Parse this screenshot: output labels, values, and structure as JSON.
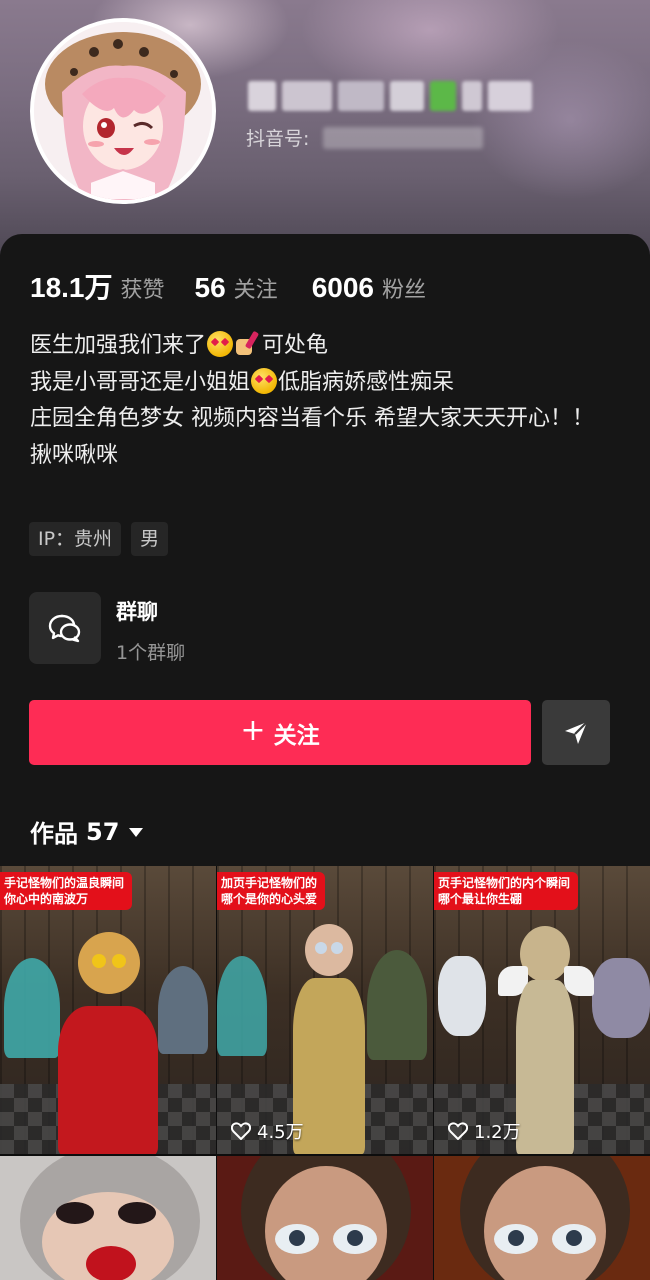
{
  "profile": {
    "douyin_id_label": "抖音号:"
  },
  "stats": [
    {
      "value": "18.1万",
      "label": "获赞"
    },
    {
      "value": "56",
      "label": "关注"
    },
    {
      "value": "6006",
      "label": "粉丝"
    }
  ],
  "bio": {
    "line1_a": "医生加强我们来了",
    "line1_b": "可处龟",
    "line2_a": "我是小哥哥还是小姐姐",
    "line2_b": "低脂病娇感性痴呆",
    "line3": "庄园全角色梦女 视频内容当看个乐 希望大家天天开心！！",
    "line4": "揪咪啾咪"
  },
  "tags": [
    "IP：贵州",
    "男"
  ],
  "group_chat": {
    "title": "群聊",
    "subtitle": "1个群聊"
  },
  "actions": {
    "follow_plus": "+",
    "follow_label": "关注"
  },
  "works": {
    "label": "作品",
    "count": "57"
  },
  "videos": [
    {
      "caption": "手记怪物们的温良瞬间\n你心中的南波万",
      "likes": ""
    },
    {
      "caption": "加页手记怪物们的\n哪个是你的心头爱",
      "likes": "4.5万"
    },
    {
      "caption": "页手记怪物们的内个瞬间\n哪个最让你生硼",
      "likes": "1.2万"
    },
    {
      "caption": "",
      "likes": ""
    },
    {
      "caption": "",
      "likes": ""
    },
    {
      "caption": "",
      "likes": ""
    }
  ],
  "colors": {
    "accent": "#fe2c55",
    "background": "#161616",
    "caption_bg": "#e3101a"
  }
}
